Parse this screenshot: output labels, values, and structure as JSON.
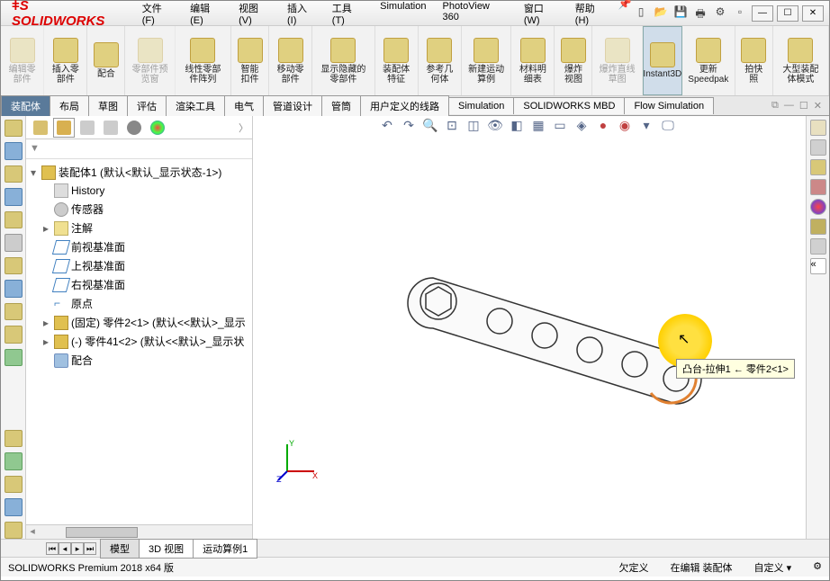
{
  "app": {
    "logo": "SOLIDWORKS"
  },
  "menu": [
    "文件(F)",
    "编辑(E)",
    "视图(V)",
    "插入(I)",
    "工具(T)",
    "Simulation",
    "PhotoView 360",
    "窗口(W)",
    "帮助(H)"
  ],
  "ribbon": [
    {
      "label": "编辑零部件",
      "disabled": true
    },
    {
      "label": "插入零部件"
    },
    {
      "label": "配合"
    },
    {
      "label": "零部件预览窗",
      "disabled": true
    },
    {
      "label": "线性零部件阵列"
    },
    {
      "label": "智能扣件"
    },
    {
      "label": "移动零部件"
    },
    {
      "label": "显示隐藏的零部件"
    },
    {
      "label": "装配体特征"
    },
    {
      "label": "参考几何体"
    },
    {
      "label": "新建运动算例"
    },
    {
      "label": "材料明细表"
    },
    {
      "label": "爆炸视图"
    },
    {
      "label": "爆炸直线草图",
      "disabled": true
    },
    {
      "label": "Instant3D",
      "active": true
    },
    {
      "label": "更新Speedpak"
    },
    {
      "label": "拍快照"
    },
    {
      "label": "大型装配体模式"
    }
  ],
  "tabs": [
    "装配体",
    "布局",
    "草图",
    "评估",
    "渲染工具",
    "电气",
    "管道设计",
    "管筒",
    "用户定义的线路",
    "Simulation",
    "SOLIDWORKS MBD",
    "Flow Simulation"
  ],
  "tree": {
    "root": "装配体1  (默认<默认_显示状态-1>)",
    "items": [
      {
        "icon": "hist",
        "label": "History"
      },
      {
        "icon": "sens",
        "label": "传感器"
      },
      {
        "icon": "note",
        "label": "注解",
        "exp": "▸"
      },
      {
        "icon": "plane",
        "label": "前视基准面"
      },
      {
        "icon": "plane",
        "label": "上视基准面"
      },
      {
        "icon": "plane",
        "label": "右视基准面"
      },
      {
        "icon": "origin",
        "label": "原点"
      },
      {
        "icon": "part",
        "label": "(固定) 零件2<1> (默认<<默认>_显示",
        "exp": "▸"
      },
      {
        "icon": "part",
        "label": "(-) 零件41<2> (默认<<默认>_显示状",
        "exp": "▸"
      },
      {
        "icon": "mate",
        "label": "配合"
      }
    ]
  },
  "tooltip": "凸台-拉伸1 ← 零件2<1>",
  "bottomTabs": [
    "模型",
    "3D 视图",
    "运动算例1"
  ],
  "status": {
    "left": "SOLIDWORKS Premium 2018 x64 版",
    "r1": "欠定义",
    "r2": "在编辑 装配体",
    "r3": "自定义"
  }
}
